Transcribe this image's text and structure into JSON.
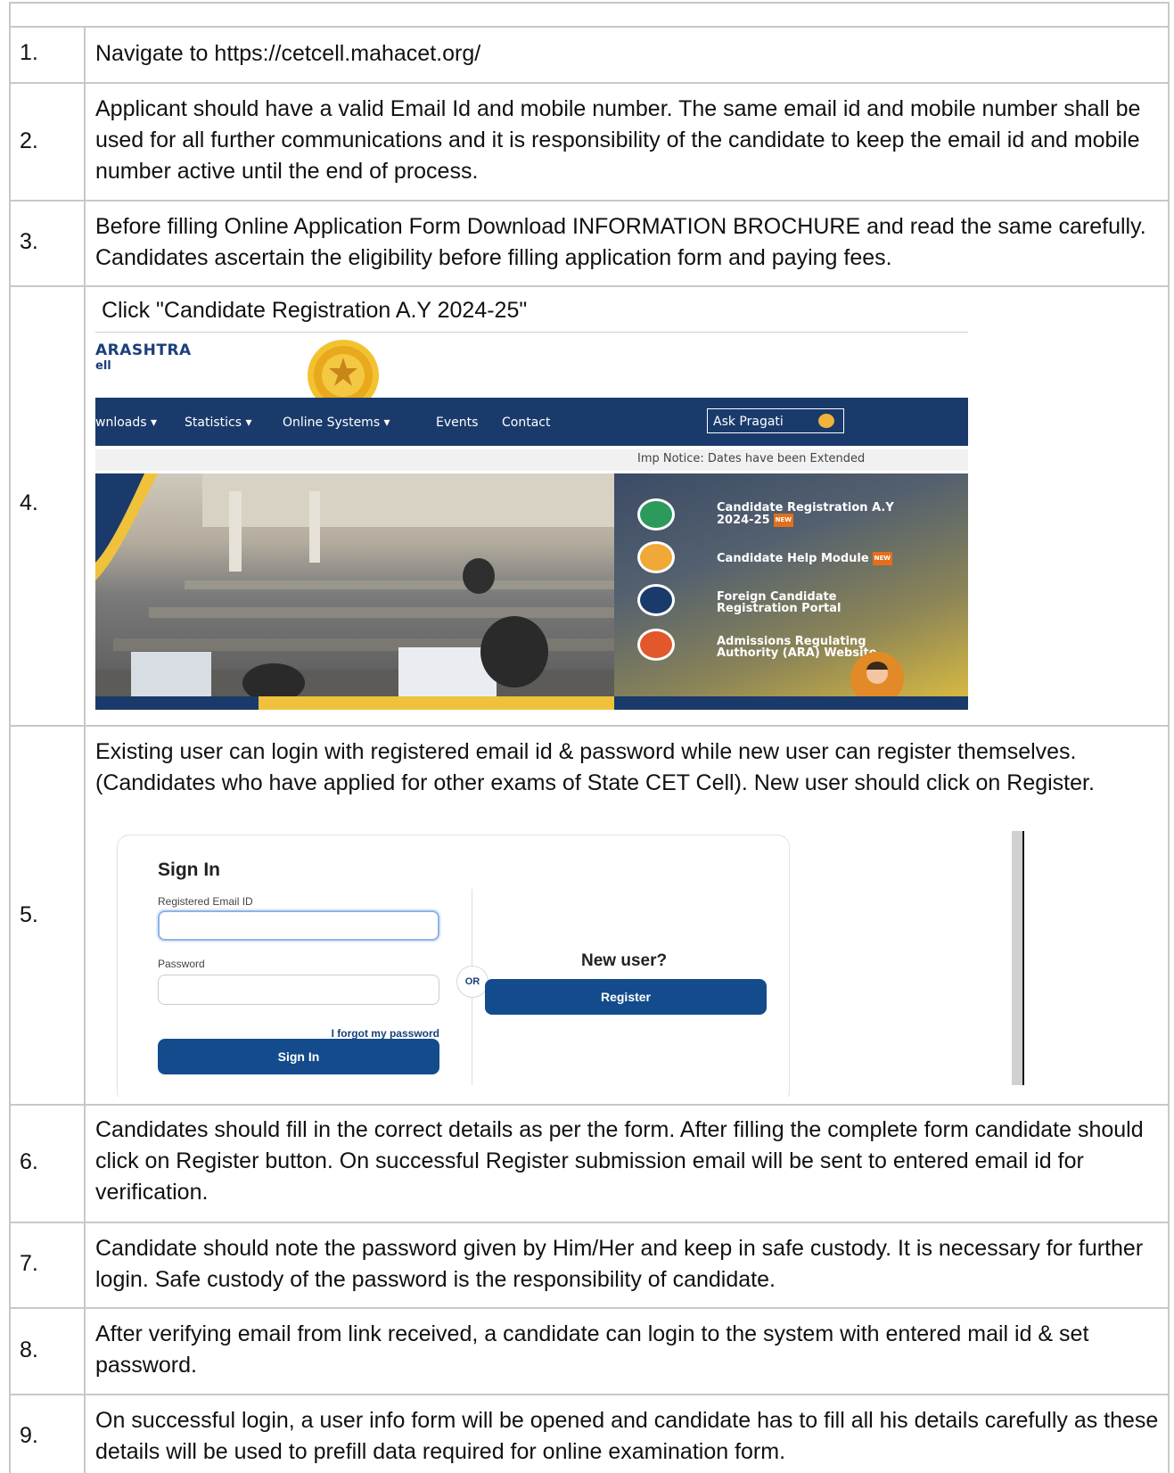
{
  "rows": [
    {
      "num": "1.",
      "text": "Navigate to https://cetcell.mahacet.org/"
    },
    {
      "num": "2.",
      "text": "Applicant should have a valid Email Id and mobile number. The same email id and mobile number shall be used for all further communications and it is responsibility of the candidate to keep the email id and mobile number active until the end of process."
    },
    {
      "num": "3.",
      "text": "Before filling Online Application Form Download INFORMATION BROCHURE and read the same carefully. Candidates ascertain the eligibility before filling application form and paying fees."
    },
    {
      "num": "4.",
      "text": " Click \"Candidate Registration A.Y 2024-25\""
    },
    {
      "num": "5.",
      "text": "Existing user can login with registered email id & password while new user can register themselves. (Candidates who have applied for other exams of State CET Cell). New user should click on Register."
    },
    {
      "num": "6.",
      "text": "Candidates should fill in the correct details as per the form. After filling the complete form candidate should click on Register button. On successful Register submission email will be sent to entered email id for verification."
    },
    {
      "num": "7.",
      "text": "Candidate should note the password given by Him/Her and keep in safe custody. It is necessary for further login. Safe custody of the password is the responsibility of candidate."
    },
    {
      "num": "8.",
      "text": "After verifying email from link received, a candidate can login to the system with entered mail id & set password."
    },
    {
      "num": "9.",
      "text": "On successful login, a user info form will be opened and candidate has to fill all his details carefully as these details will be used to prefill data required for online examination form."
    }
  ],
  "site": {
    "brand_line1": "ARASHTRA",
    "brand_line2": "ell",
    "nav": [
      "wnloads ▾",
      "Statistics ▾",
      "Online Systems ▾",
      "Events",
      "Contact"
    ],
    "ask": "Ask Pragati",
    "notice": "Imp Notice: Dates have been Extended",
    "links": [
      {
        "label": "Candidate Registration A.Y 2024-25",
        "new": "NEW",
        "color": "#2b9a5a"
      },
      {
        "label": "Candidate Help Module",
        "new": "NEW",
        "color": "#f0a838"
      },
      {
        "label": "Foreign Candidate Registration Portal",
        "new": "",
        "color": "#1a3a6b"
      },
      {
        "label": "Admissions Regulating Authority (ARA) Website",
        "new": "",
        "color": "#e2572b"
      }
    ]
  },
  "signin": {
    "title": "Sign In",
    "email_label": "Registered Email ID",
    "email_value": "",
    "password_label": "Password",
    "password_value": "",
    "forgot": "I forgot my password",
    "signin_button": "Sign In",
    "or": "OR",
    "new_user": "New user?",
    "register_button": "Register"
  }
}
